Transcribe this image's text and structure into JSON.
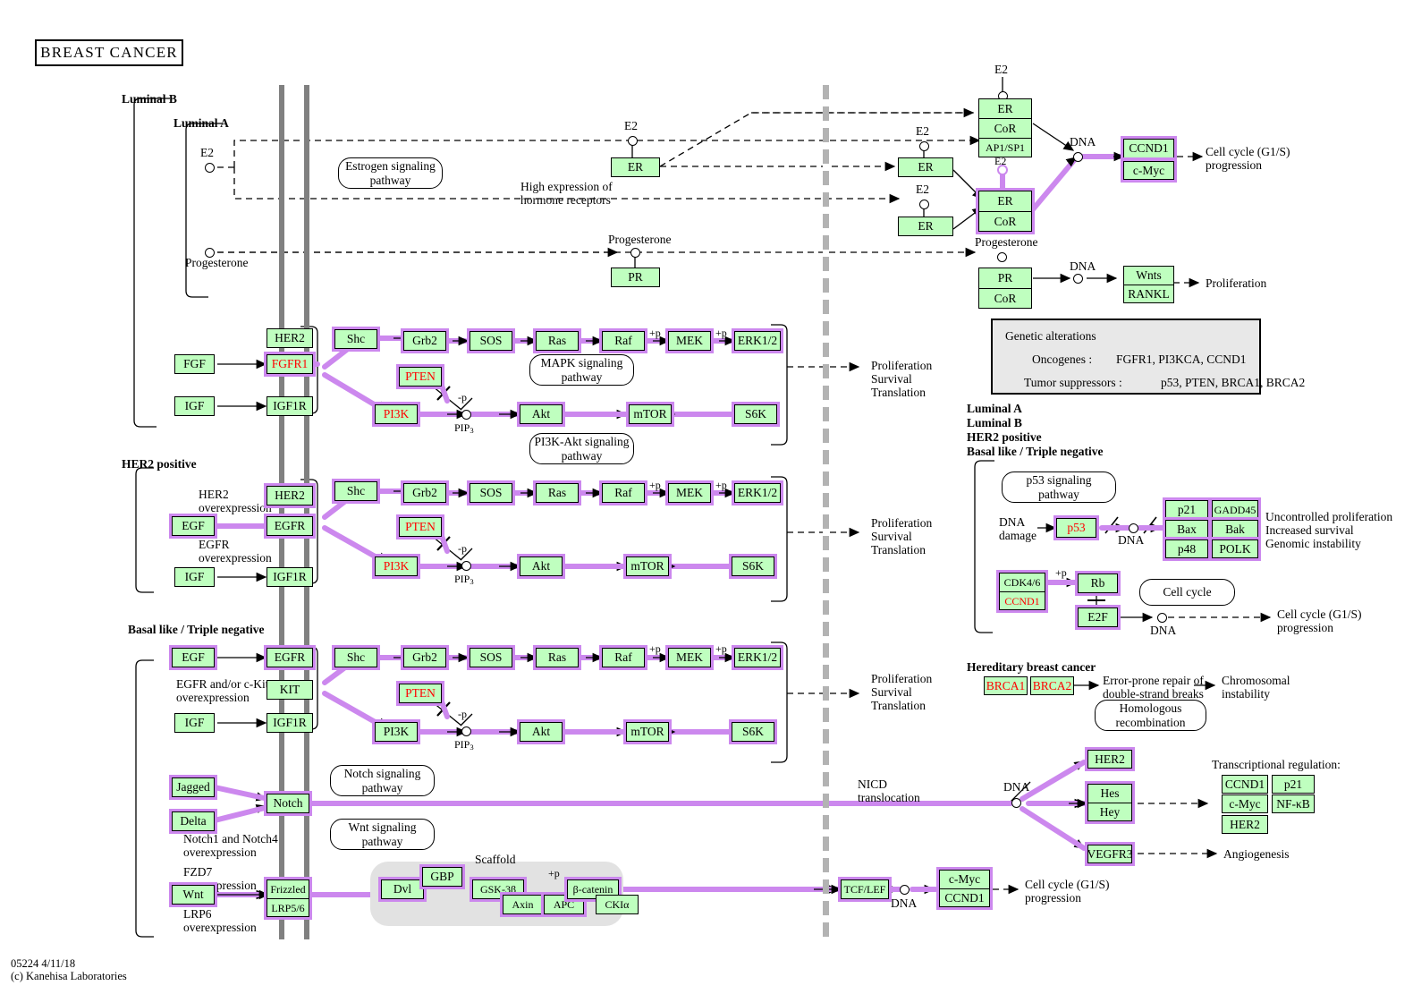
{
  "title": "BREAST  CANCER",
  "footer": "05224 4/11/18\n(c) Kanehisa Laboratories",
  "subtype_labels": {
    "luminal_b": "Luminal B",
    "luminal_a": "Luminal A",
    "her2_positive": "HER2 positive",
    "basal": "Basal like / Triple negative"
  },
  "ligands": {
    "e2_left": "E2",
    "progesterone_left": "Progesterone",
    "e2_mid": "E2",
    "progesterone_mid": "Progesterone",
    "e2_top_right": "E2",
    "e2_right_a": "E2",
    "e2_right_b": "E2",
    "progesterone_right": "Progesterone"
  },
  "pathway_capsules": {
    "estrogen": "Estrogen signaling\npathway",
    "mapk": "MAPK signaling\npathway",
    "pi3k_akt": "PI3K-Akt signaling\npathway",
    "notch": "Notch signaling\npathway",
    "wnt": "Wnt signaling\npathway",
    "p53": "p53 signaling\npathway",
    "cell_cycle": "Cell cycle",
    "homologous_recombination": "Homologous\nrecombination"
  },
  "annotations": {
    "high_expression": "High expression of\nhormone receptors",
    "dna_1": "DNA",
    "dna_2": "DNA",
    "dna_p53": "DNA",
    "dna_e2f": "DNA",
    "dna_notch": "DNA",
    "dna_wnt": "DNA",
    "cell_cycle_g1s_1": "Cell cycle (G1/S)\nprogression",
    "cell_cycle_g1s_2": "Cell cycle (G1/S)\nprogression",
    "cell_cycle_g1s_3": "Cell cycle (G1/S)\nprogression",
    "proliferation": "Proliferation",
    "pst_1": "Proliferation\nSurvival\nTranslation",
    "pst_2": "Proliferation\nSurvival\nTranslation",
    "pst_3": "Proliferation\nSurvival\nTranslation",
    "uncontrolled": "Uncontrolled proliferation\nIncreased survival\nGenomic instability",
    "her2_over": "HER2\noverexpression",
    "egfr_over": "EGFR\noverexpression",
    "egfr_kit_over": "EGFR and/or c-Kit\noverexpression",
    "notch_over": "Notch1 and Notch4\noverexpression",
    "fzd7_over": "FZD7\noverexpression",
    "lrp6_over": "LRP6\noverexpression",
    "nicd": "NICD\ntranslocation",
    "angiogenesis": "Angiogenesis",
    "scaffold": "Scaffold",
    "dna_damage": "DNA\ndamage",
    "error_prone": "Error-prone repair of\ndouble-strand breaks",
    "chromosomal_instability": "Chromosomal\ninstability",
    "transcriptional_regulation": "Transcriptional regulation:",
    "hereditary": "Hereditary breast cancer",
    "pip3": "PIP",
    "pip3_sub": "3",
    "plus_p": "+p",
    "minus_p": "-p"
  },
  "genetic_alterations": {
    "heading": "Genetic alterations",
    "oncogenes_label": "Oncogenes :",
    "oncogenes_value": "FGFR1, PI3KCA, CCND1",
    "tumor_label": "Tumor suppressors :",
    "tumor_value": "p53, PTEN, BRCA1, BRCA2"
  },
  "subtype_list": [
    "Luminal A",
    "Luminal B",
    "HER2 positive",
    "Basal like / Triple negative"
  ],
  "nodes": {
    "er_top": "ER",
    "cor_top": "CoR",
    "ap1sp1": "AP1/SP1",
    "er_mid": "ER",
    "er_lower": "ER",
    "er_nuc": "ER",
    "cor_nuc": "CoR",
    "er_center": "ER",
    "pr_center": "PR",
    "pr_nuc": "PR",
    "cor_pr": "CoR",
    "ccnd1_top": "CCND1",
    "cmyc_top": "c-Myc",
    "wnts": "Wnts",
    "rankl": "RANKL",
    "fgf": "FGF",
    "igf_a": "IGF",
    "her2_a": "HER2",
    "fgfr1": "FGFR1",
    "igf1r_a": "IGF1R",
    "shc_a": "Shc",
    "grb2_a": "Grb2",
    "sos_a": "SOS",
    "ras_a": "Ras",
    "raf_a": "Raf",
    "mek_a": "MEK",
    "erk_a": "ERK1/2",
    "pten_a": "PTEN",
    "pi3k_a": "PI3K",
    "akt_a": "Akt",
    "mtor_a": "mTOR",
    "s6k_a": "S6K",
    "her2_b": "HER2",
    "egf_b": "EGF",
    "egfr_b": "EGFR",
    "igf_b": "IGF",
    "igf1r_b": "IGF1R",
    "shc_b": "Shc",
    "grb2_b": "Grb2",
    "sos_b": "SOS",
    "ras_b": "Ras",
    "raf_b": "Raf",
    "mek_b": "MEK",
    "erk_b": "ERK1/2",
    "pten_b": "PTEN",
    "pi3k_b": "PI3K",
    "akt_b": "Akt",
    "mtor_b": "mTOR",
    "s6k_b": "S6K",
    "egf_c": "EGF",
    "egfr_c": "EGFR",
    "kit_c": "KIT",
    "igf_c": "IGF",
    "igf1r_c": "IGF1R",
    "shc_c": "Shc",
    "grb2_c": "Grb2",
    "sos_c": "SOS",
    "ras_c": "Ras",
    "raf_c": "Raf",
    "mek_c": "MEK",
    "erk_c": "ERK1/2",
    "pten_c": "PTEN",
    "pi3k_c": "PI3K",
    "akt_c": "Akt",
    "mtor_c": "mTOR",
    "s6k_c": "S6K",
    "jagged": "Jagged",
    "delta": "Delta",
    "notch": "Notch",
    "wnt": "Wnt",
    "frizzled": "Frizzled",
    "lrp56": "LRP5/6",
    "dvl": "Dvl",
    "gbp": "GBP",
    "gsk3b": "GSK-3β",
    "axin": "Axin",
    "apc": "APC",
    "bcatenin": "β-catenin",
    "ckia": "CKIα",
    "tcflef": "TCF/LEF",
    "cmyc_wnt": "c-Myc",
    "ccnd1_wnt": "CCND1",
    "her2_nicd": "HER2",
    "hes": "Hes",
    "hey": "Hey",
    "vegfr3": "VEGFR3",
    "p53": "p53",
    "p21": "p21",
    "gadd45": "GADD45",
    "bax": "Bax",
    "bak": "Bak",
    "p48": "p48",
    "polk": "POLK",
    "cdk46": "CDK4/6",
    "ccnd1_cdk": "CCND1",
    "rb": "Rb",
    "e2f": "E2F",
    "brca1": "BRCA1",
    "brca2": "BRCA2",
    "tr_ccnd1": "CCND1",
    "tr_p21": "p21",
    "tr_cmyc": "c-Myc",
    "tr_nfkb": "NF-κB",
    "tr_her2": "HER2"
  },
  "colors": {
    "node_fill": "#bfffbf",
    "highlight": "#cc88ee",
    "red_text": "#ff0000",
    "membrane": "#808080",
    "nuclear_membrane": "#b3b3b3",
    "info_fill": "#e8e8e8",
    "scaffold_fill": "#e2e2e2"
  }
}
